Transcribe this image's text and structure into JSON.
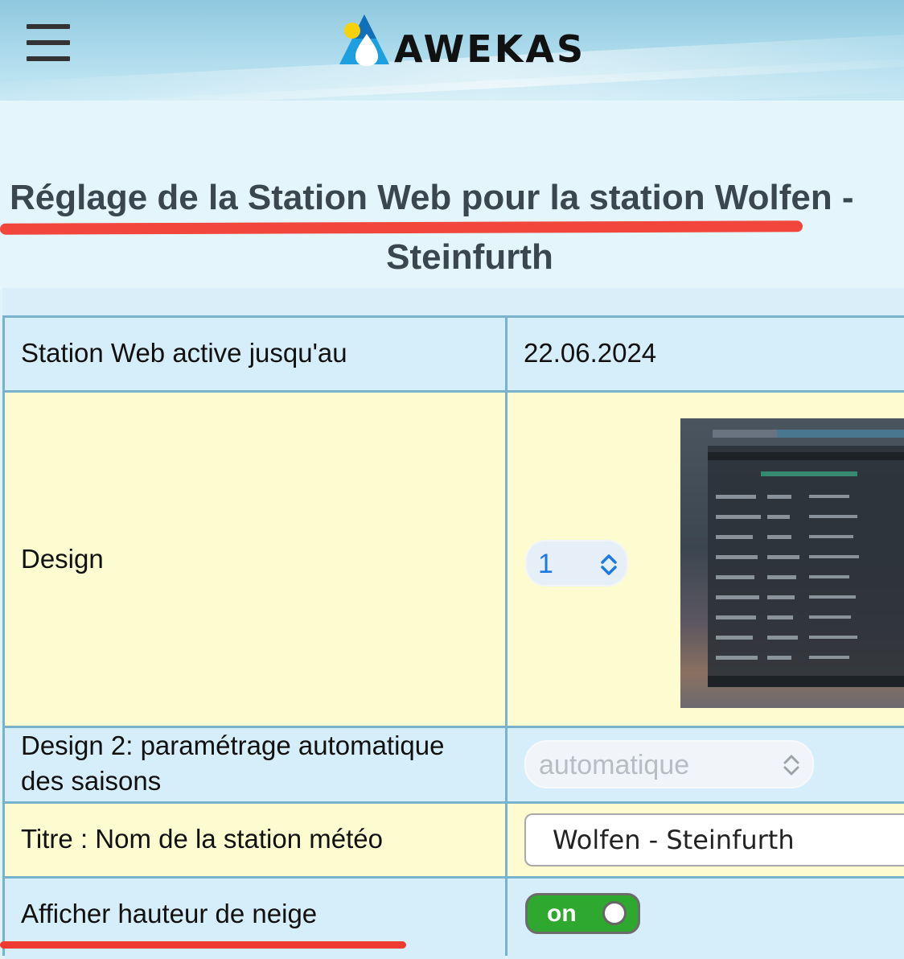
{
  "header": {
    "logo_text": "AWEKAS",
    "menu_icon": "hamburger-menu-icon"
  },
  "page": {
    "title_line1": "Réglage de la Station Web pour la station Wolfen -",
    "title_line2": "Steinfurth"
  },
  "settings": {
    "active_until_label": "Station Web active jusqu'au",
    "active_until_value": "22.06.2024",
    "design_label": "Design",
    "design_selected": "1",
    "design2_label_line1": "Design 2: paramétrage automatique",
    "design2_label_line2": "des saisons",
    "design2_selected": "automatique",
    "title_label": "Titre : Nom de la station météo",
    "title_value": "Wolfen - Steinfurth",
    "snow_label": "Afficher hauteur de neige",
    "snow_toggle": "on"
  },
  "colors": {
    "row_blue": "#d6eefa",
    "row_yellow": "#fdfbd0",
    "grid": "#79b2cc",
    "highlight_red": "#f23b30",
    "toggle_green": "#2ea82e",
    "select_blue": "#1c7ae0"
  }
}
